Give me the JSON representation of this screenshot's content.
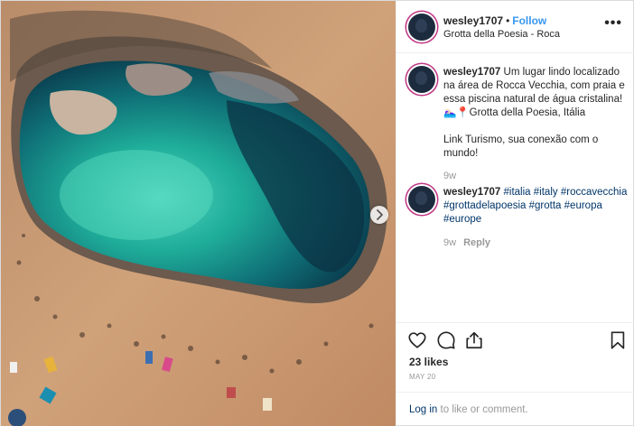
{
  "post": {
    "image_alt": "Aerial view of Grotta della Poesia natural pool",
    "colors": {
      "link": "#3897f0",
      "hashtag": "#003569",
      "muted": "#999999"
    }
  },
  "header": {
    "username": "wesley1707",
    "separator": "•",
    "follow_label": "Follow",
    "location": "Grotta della Poesia - Roca",
    "more_icon": "more-horizontal-icon",
    "more_label": "•••"
  },
  "comments": [
    {
      "username": "wesley1707",
      "text_line1": "Um lugar lindo localizado na área de Rocca Vecchia, com praia e essa piscina natural de água cristalina!",
      "text_line2": "🏊🏻‍♀️📍Grotta della Poesia, Itália",
      "text_line3": "Link Turismo, sua conexão com o mundo!",
      "time": "9w"
    },
    {
      "username": "wesley1707",
      "tags": [
        "#italia",
        "#italy",
        "#roccavecchia",
        "#grottadelapoesia",
        "#grotta",
        "#europa",
        "#europe"
      ],
      "time": "9w",
      "reply_label": "Reply"
    }
  ],
  "actions": {
    "icons": [
      "heart-icon",
      "comment-icon",
      "share-icon",
      "bookmark-icon"
    ],
    "likes": "23 likes",
    "date": "MAY 20"
  },
  "login_prompt": {
    "link_text": "Log in",
    "rest_text": " to like or comment."
  }
}
